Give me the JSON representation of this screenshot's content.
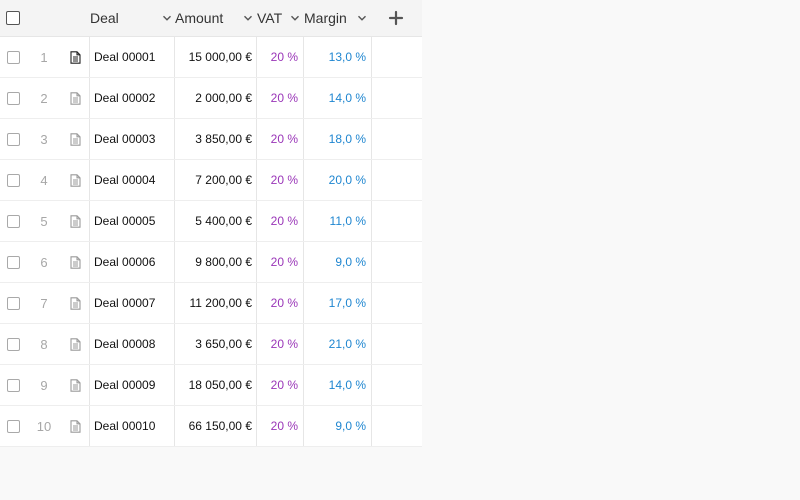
{
  "columns": {
    "deal": "Deal",
    "amount": "Amount",
    "vat": "VAT",
    "margin": "Margin"
  },
  "rows": [
    {
      "num": "1",
      "deal": "Deal 00001",
      "amount": "15 000,00 €",
      "vat": "20 %",
      "margin": "13,0 %"
    },
    {
      "num": "2",
      "deal": "Deal 00002",
      "amount": "2 000,00 €",
      "vat": "20 %",
      "margin": "14,0 %"
    },
    {
      "num": "3",
      "deal": "Deal 00003",
      "amount": "3 850,00 €",
      "vat": "20 %",
      "margin": "18,0 %"
    },
    {
      "num": "4",
      "deal": "Deal 00004",
      "amount": "7 200,00 €",
      "vat": "20 %",
      "margin": "20,0 %"
    },
    {
      "num": "5",
      "deal": "Deal 00005",
      "amount": "5 400,00 €",
      "vat": "20 %",
      "margin": "11,0 %"
    },
    {
      "num": "6",
      "deal": "Deal 00006",
      "amount": "9 800,00 €",
      "vat": "20 %",
      "margin": "9,0 %"
    },
    {
      "num": "7",
      "deal": "Deal 00007",
      "amount": "11 200,00 €",
      "vat": "20 %",
      "margin": "17,0 %"
    },
    {
      "num": "8",
      "deal": "Deal 00008",
      "amount": "3 650,00 €",
      "vat": "20 %",
      "margin": "21,0 %"
    },
    {
      "num": "9",
      "deal": "Deal 00009",
      "amount": "18 050,00 €",
      "vat": "20 %",
      "margin": "14,0 %"
    },
    {
      "num": "10",
      "deal": "Deal 00010",
      "amount": "66 150,00 €",
      "vat": "20 %",
      "margin": "9,0 %"
    }
  ],
  "colors": {
    "vat_text": "#9a36b8",
    "margin_text": "#1f86d0",
    "row_number": "#a7a7a7"
  },
  "icons": {
    "select_all": "checkbox-icon",
    "row_select": "checkbox-icon",
    "row_doc": "document-icon",
    "sort": "chevron-down-icon",
    "add_column": "plus-icon"
  }
}
